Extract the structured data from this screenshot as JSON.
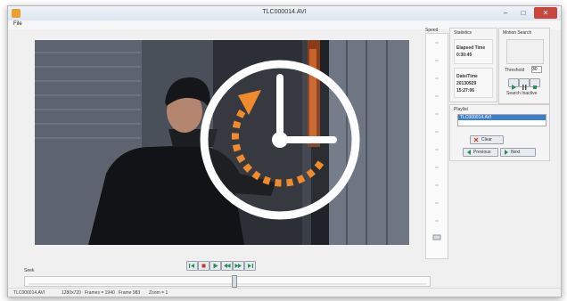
{
  "window": {
    "title": "TLC000014.AVI",
    "menu_file": "File"
  },
  "speed": {
    "label": "Speed"
  },
  "statistics": {
    "title": "Statistics",
    "elapsed_label": "Elapsed Time",
    "elapsed_value": "0:30:45",
    "date_label": "Date/Time",
    "date_value": "20130929",
    "time_value": "15:27:06"
  },
  "motion": {
    "title": "Motion Search",
    "threshold_label": "Threshold",
    "threshold_value": "30",
    "status_label": "Search Inactive"
  },
  "playlist": {
    "title": "Playlist",
    "items": [
      "TLC000014.AVI"
    ],
    "clear_label": "Clear",
    "previous_label": "Previous",
    "next_label": "Next"
  },
  "seek": {
    "label": "Seek",
    "position": 0.52
  },
  "status": {
    "file": "TLC000014.AVI",
    "resolution": "1280x720",
    "frames": "Frames = 1940",
    "frame": "Frame 983",
    "zoom": "Zoom = 1"
  },
  "colors": {
    "accent_orange": "#f08a2a",
    "selection": "#3b7fd0",
    "close_button": "#c9463d"
  }
}
